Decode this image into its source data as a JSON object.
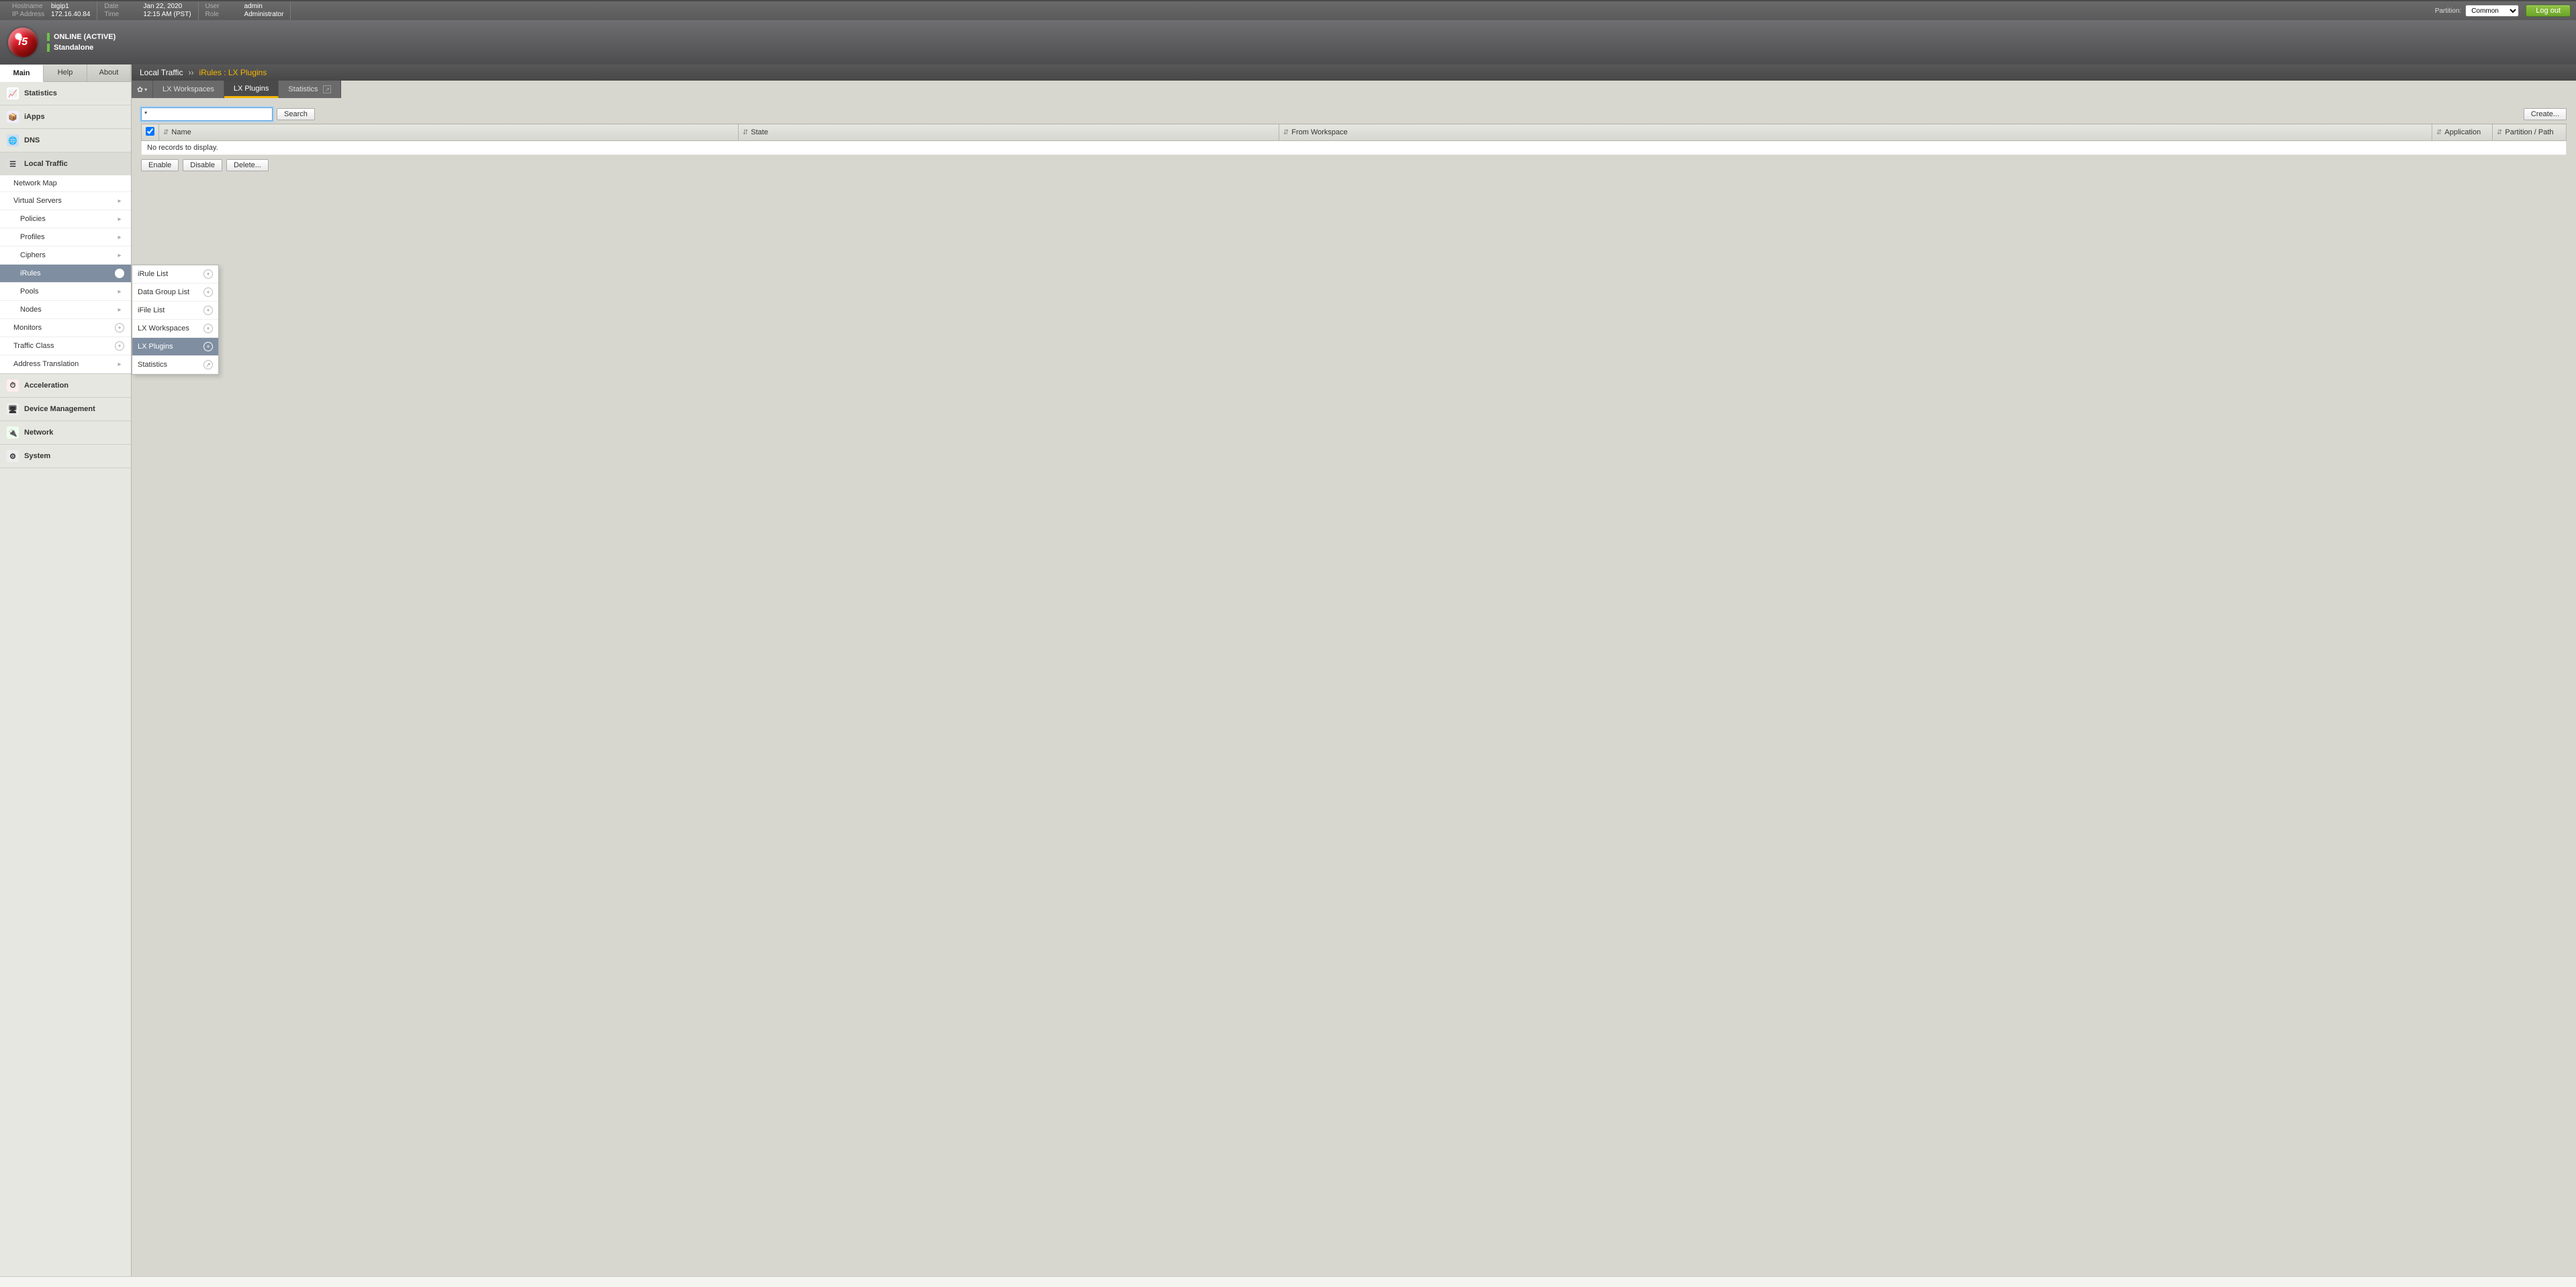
{
  "topbar": {
    "hostname_lbl": "Hostname",
    "hostname": "bigip1",
    "ip_lbl": "IP Address",
    "ip": "172.16.40.84",
    "date_lbl": "Date",
    "date": "Jan 22, 2020",
    "time_lbl": "Time",
    "time": "12:15 AM (PST)",
    "user_lbl": "User",
    "user": "admin",
    "role_lbl": "Role",
    "role": "Administrator",
    "partition_lbl": "Partition:",
    "partition_value": "Common",
    "logout": "Log out"
  },
  "banner": {
    "status": "ONLINE (ACTIVE)",
    "mode": "Standalone"
  },
  "side_tabs": {
    "main": "Main",
    "help": "Help",
    "about": "About"
  },
  "nav": [
    {
      "label": "Statistics"
    },
    {
      "label": "iApps"
    },
    {
      "label": "DNS"
    },
    {
      "label": "Local Traffic"
    },
    {
      "label": "Acceleration"
    },
    {
      "label": "Device Management"
    },
    {
      "label": "Network"
    },
    {
      "label": "System"
    }
  ],
  "lt_sub": [
    {
      "label": "Network Map"
    },
    {
      "label": "Virtual Servers",
      "arrow": true
    },
    {
      "label": "Policies",
      "indent": true,
      "arrow": true
    },
    {
      "label": "Profiles",
      "indent": true,
      "arrow": true
    },
    {
      "label": "Ciphers",
      "indent": true,
      "arrow": true
    },
    {
      "label": "iRules",
      "indent": true,
      "arrow": true,
      "sel": true
    },
    {
      "label": "Pools",
      "indent": true,
      "arrow": true
    },
    {
      "label": "Nodes",
      "indent": true,
      "arrow": true
    },
    {
      "label": "Monitors",
      "plus": true
    },
    {
      "label": "Traffic Class",
      "plus": true
    },
    {
      "label": "Address Translation",
      "arrow": true
    }
  ],
  "flyout": [
    {
      "label": "iRule List",
      "plus": true
    },
    {
      "label": "Data Group List",
      "plus": true
    },
    {
      "label": "iFile List",
      "plus": true
    },
    {
      "label": "LX Workspaces",
      "plus": true
    },
    {
      "label": "LX Plugins",
      "plus": true,
      "sel": true
    },
    {
      "label": "Statistics",
      "ext": true
    }
  ],
  "crumb": {
    "section": "Local Traffic",
    "page": "iRules : LX Plugins"
  },
  "mtabs": {
    "lxw": "LX Workspaces",
    "lxp": "LX Plugins",
    "stats": "Statistics"
  },
  "search": {
    "value": "*",
    "btn": "Search",
    "create": "Create..."
  },
  "grid": {
    "cols": {
      "name": "Name",
      "state": "State",
      "from": "From Workspace",
      "app": "Application",
      "part": "Partition / Path"
    },
    "empty": "No records to display."
  },
  "actions": {
    "enable": "Enable",
    "disable": "Disable",
    "delete": "Delete..."
  },
  "footer": ""
}
